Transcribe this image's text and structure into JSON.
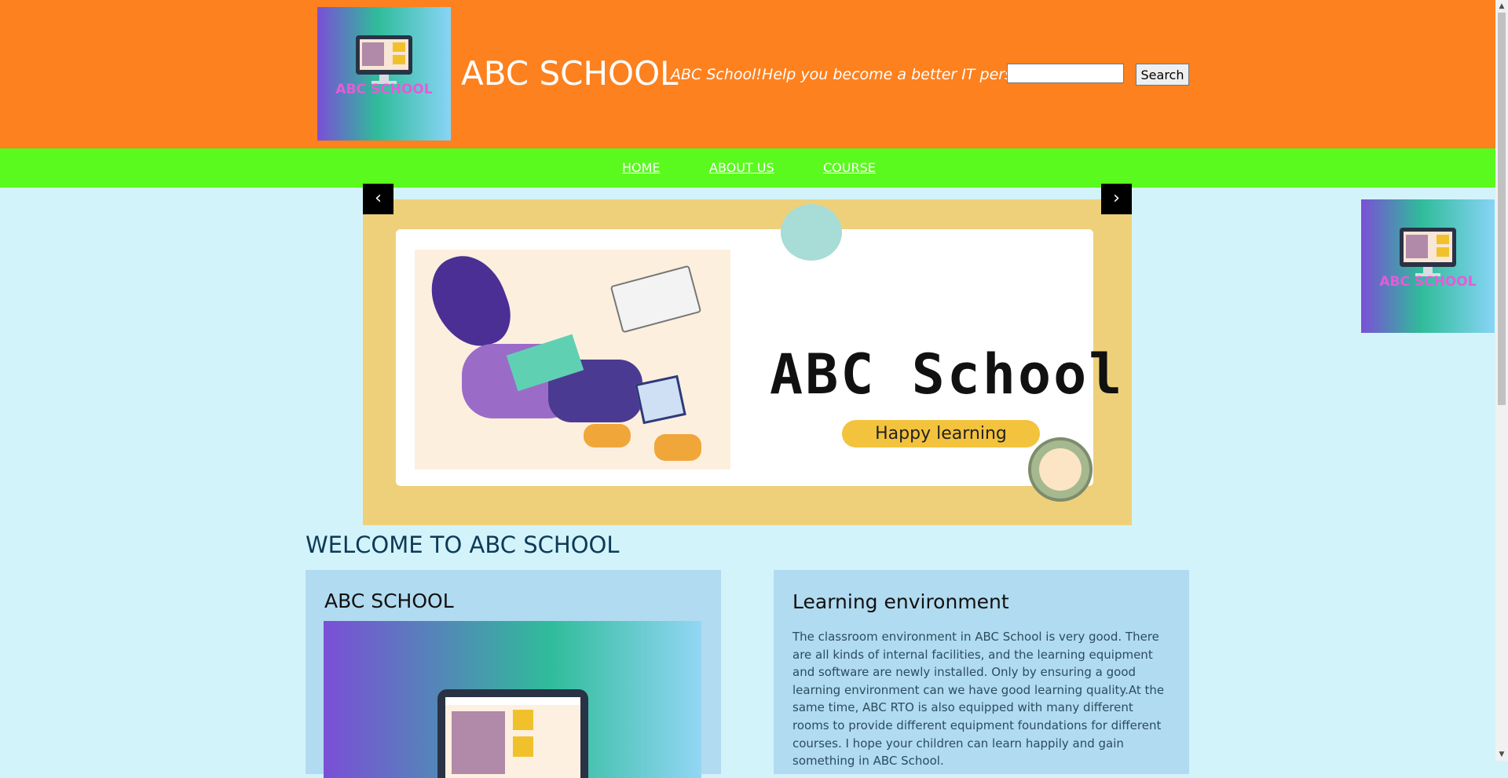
{
  "header": {
    "logo_text": "ABC SCHOOL",
    "title": "ABC SCHOOL",
    "slogan": "ABC School!Help you become a better IT person!",
    "search_value": "",
    "search_button": "Search"
  },
  "nav": {
    "items": [
      {
        "label": "HOME"
      },
      {
        "label": "ABOUT US"
      },
      {
        "label": "COURSE"
      }
    ]
  },
  "slider": {
    "title": "ABC  School",
    "subtitle": "Happy learning",
    "prev_label": "‹",
    "next_label": "›"
  },
  "side_logo": {
    "text": "ABC SCHOOL"
  },
  "main": {
    "welcome": "WELCOME TO ABC SCHOOL",
    "card_left": {
      "title": "ABC SCHOOL"
    },
    "card_right": {
      "title": "Learning environment",
      "text": "The classroom environment in ABC School is very good. There are all kinds of internal facilities, and the learning equipment and software are newly installed. Only by ensuring a good learning environment can we have good learning quality.At the same time, ABC RTO is also equipped with many different rooms to provide different equipment foundations for different courses. I hope your children can learn happily and gain something in ABC School."
    }
  },
  "colors": {
    "header_bg": "#fd811e",
    "nav_bg": "#5afa1e",
    "page_bg": "#d3f3fb",
    "card_bg": "#b1dbf0",
    "slider_frame": "#efd07a"
  }
}
